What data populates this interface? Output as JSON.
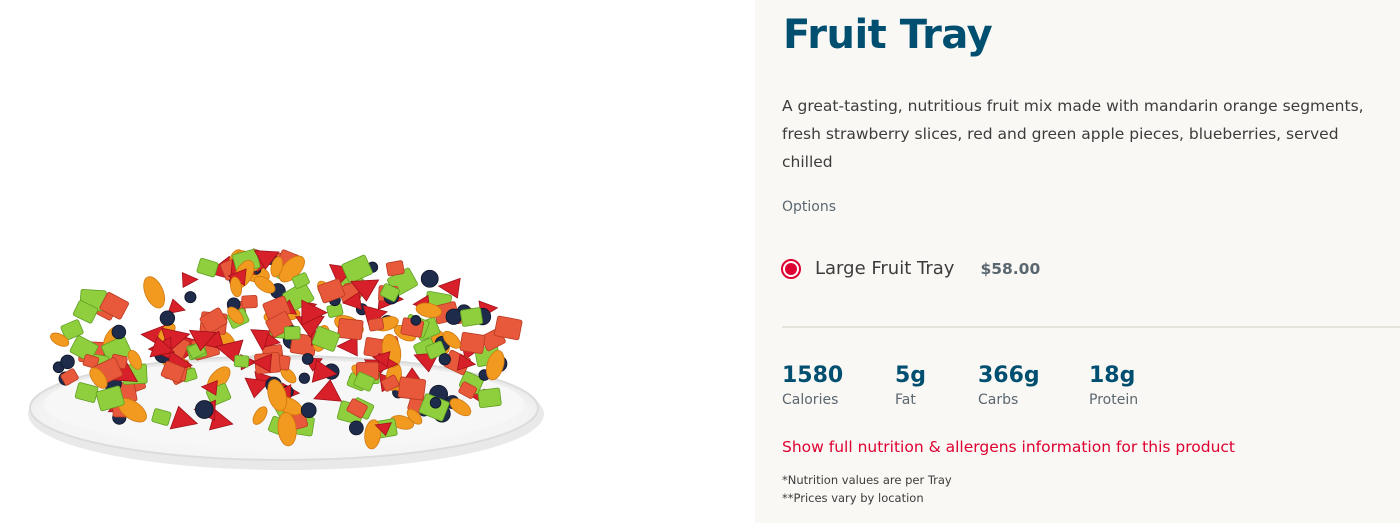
{
  "product": {
    "title": "Fruit Tray",
    "description": "A great-tasting, nutritious fruit mix made with mandarin orange segments, fresh strawberry slices, red and green apple pieces, blueberries, served chilled",
    "image_alt": "Fruit tray with mandarin oranges, strawberries, apples and blueberries"
  },
  "options": {
    "label": "Options",
    "items": [
      {
        "name": "Large Fruit Tray",
        "price": "$58.00",
        "selected": true
      }
    ]
  },
  "nutrition": {
    "items": [
      {
        "value": "1580",
        "label": "Calories"
      },
      {
        "value": "5g",
        "label": "Fat"
      },
      {
        "value": "366g",
        "label": "Carbs"
      },
      {
        "value": "18g",
        "label": "Protein"
      }
    ],
    "link_text": "Show full nutrition & allergens information for this product"
  },
  "footnotes": [
    "*Nutrition values are per Tray",
    "**Prices vary by location"
  ],
  "colors": {
    "brand_red": "#dd0031",
    "brand_navy": "#004f71",
    "panel_bg": "#faf8f4"
  }
}
